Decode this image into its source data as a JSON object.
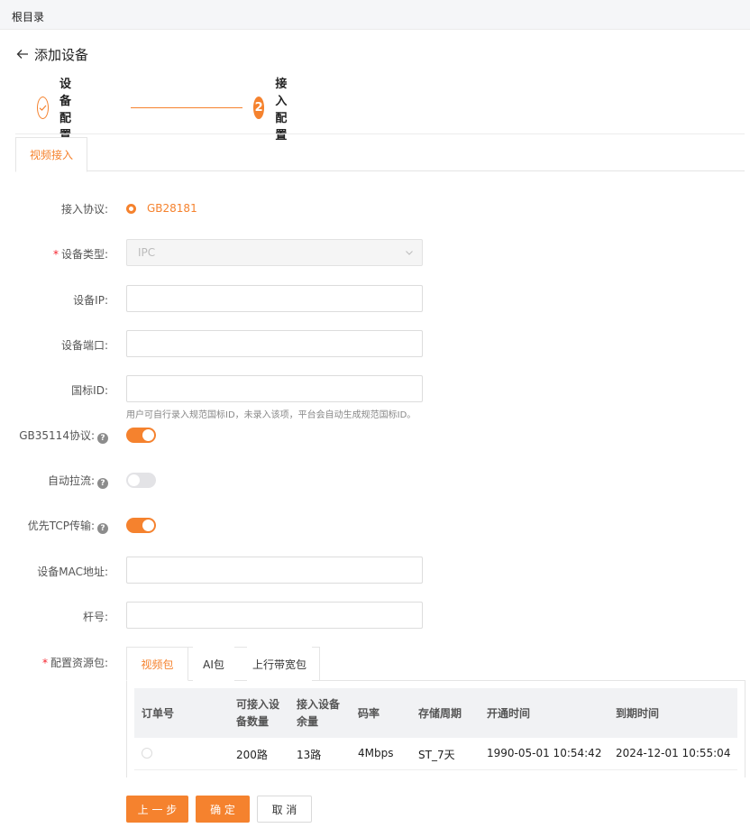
{
  "breadcrumb": "根目录",
  "page": {
    "title": "添加设备"
  },
  "steps": [
    {
      "label": "设备配置",
      "status": "done"
    },
    {
      "label": "接入配置",
      "number": "2",
      "status": "active"
    }
  ],
  "tabs": {
    "active": "视频接入"
  },
  "form": {
    "protocol": {
      "label": "接入协议:",
      "value": "GB28181"
    },
    "device_type": {
      "label": "设备类型:",
      "value": "IPC"
    },
    "device_ip": {
      "label": "设备IP:",
      "value": ""
    },
    "device_port": {
      "label": "设备端口:",
      "value": ""
    },
    "gb_id": {
      "label": "国标ID:",
      "value": "",
      "hint": "用户可自行录入规范国标ID，未录入该项，平台会自动生成规范国标ID。"
    },
    "gb35114": {
      "label": "GB35114协议:",
      "on": true
    },
    "auto_pull": {
      "label": "自动拉流:",
      "on": false
    },
    "tcp_first": {
      "label": "优先TCP传输:",
      "on": true
    },
    "mac": {
      "label": "设备MAC地址:",
      "value": ""
    },
    "pole": {
      "label": "杆号:",
      "value": ""
    },
    "package": {
      "label": "配置资源包:"
    }
  },
  "package_tabs": [
    "视频包",
    "AI包",
    "上行带宽包"
  ],
  "package_table": {
    "headers": {
      "order": "订单号",
      "capacity_1": "可接入设",
      "capacity_2": "备数量",
      "remaining_1": "接入设备",
      "remaining_2": "余量",
      "bitrate": "码率",
      "storage": "存储周期",
      "start": "开通时间",
      "end": "到期时间"
    },
    "rows": [
      {
        "order": "",
        "capacity": "200路",
        "remaining": "13路",
        "bitrate": "4Mbps",
        "storage": "ST_7天",
        "start": "1990-05-01 10:54:42",
        "end": "2024-12-01 10:55:04"
      }
    ]
  },
  "buttons": {
    "prev": "上 一 步",
    "confirm": "确 定",
    "cancel": "取 消"
  },
  "icons": {
    "back": "arrow-left-icon",
    "check": "check-icon",
    "help": "question-circle-icon",
    "dropdown": "chevron-down-icon"
  },
  "colors": {
    "accent": "#f5822e",
    "required": "#f5222d"
  }
}
